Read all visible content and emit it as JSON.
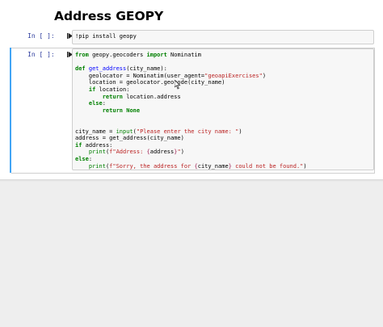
{
  "notebook": {
    "heading": "Address GEOPY",
    "cells": [
      {
        "prompt": "In [ ]:",
        "lines": [
          [
            {
              "t": "!pip install geopy",
              "c": ""
            }
          ]
        ]
      },
      {
        "prompt": "In [ ]:",
        "lines": [
          [
            {
              "t": "from",
              "c": "kw"
            },
            {
              "t": " geopy.geocoders ",
              "c": ""
            },
            {
              "t": "import",
              "c": "kw"
            },
            {
              "t": " Nominatim",
              "c": ""
            }
          ],
          [],
          [
            {
              "t": "def",
              "c": "kw"
            },
            {
              "t": " ",
              "c": ""
            },
            {
              "t": "get_address",
              "c": "fn"
            },
            {
              "t": "(city_name):",
              "c": ""
            }
          ],
          [
            {
              "t": "    geolocator = Nominatim(user_agent=",
              "c": ""
            },
            {
              "t": "\"geoapiExercises\"",
              "c": "str"
            },
            {
              "t": ")",
              "c": ""
            }
          ],
          [
            {
              "t": "    location = geolocator.geocode(city_name)",
              "c": ""
            }
          ],
          [
            {
              "t": "    ",
              "c": ""
            },
            {
              "t": "if",
              "c": "kw"
            },
            {
              "t": " location:",
              "c": ""
            }
          ],
          [
            {
              "t": "        ",
              "c": ""
            },
            {
              "t": "return",
              "c": "kw"
            },
            {
              "t": " location.address",
              "c": ""
            }
          ],
          [
            {
              "t": "    ",
              "c": ""
            },
            {
              "t": "else",
              "c": "kw"
            },
            {
              "t": ":",
              "c": ""
            }
          ],
          [
            {
              "t": "        ",
              "c": ""
            },
            {
              "t": "return",
              "c": "kw"
            },
            {
              "t": " ",
              "c": ""
            },
            {
              "t": "None",
              "c": "kw"
            }
          ],
          [],
          [],
          [
            {
              "t": "city_name = ",
              "c": ""
            },
            {
              "t": "input",
              "c": "bi"
            },
            {
              "t": "(",
              "c": ""
            },
            {
              "t": "\"Please enter the city name: \"",
              "c": "str"
            },
            {
              "t": ")",
              "c": ""
            }
          ],
          [
            {
              "t": "address = get_address(city_name)",
              "c": ""
            }
          ],
          [
            {
              "t": "if",
              "c": "kw"
            },
            {
              "t": " address:",
              "c": ""
            }
          ],
          [
            {
              "t": "    ",
              "c": ""
            },
            {
              "t": "print",
              "c": "bi"
            },
            {
              "t": "(",
              "c": ""
            },
            {
              "t": "f\"Address: ",
              "c": "str"
            },
            {
              "t": "{",
              "c": "sub"
            },
            {
              "t": "address",
              "c": ""
            },
            {
              "t": "}",
              "c": "sub"
            },
            {
              "t": "\"",
              "c": "str"
            },
            {
              "t": ")",
              "c": ""
            }
          ],
          [
            {
              "t": "else",
              "c": "kw"
            },
            {
              "t": ":",
              "c": ""
            }
          ],
          [
            {
              "t": "    ",
              "c": ""
            },
            {
              "t": "print",
              "c": "bi"
            },
            {
              "t": "(",
              "c": ""
            },
            {
              "t": "f\"Sorry, the address for ",
              "c": "str"
            },
            {
              "t": "{",
              "c": "sub"
            },
            {
              "t": "city_name",
              "c": ""
            },
            {
              "t": "}",
              "c": "sub"
            },
            {
              "t": " could not be found.\"",
              "c": "str"
            },
            {
              "t": ")",
              "c": ""
            }
          ]
        ]
      }
    ]
  },
  "icons": {
    "run": "run-cell-icon",
    "cursor": "text-cursor-icon"
  },
  "colors": {
    "selected_cell_bar": "#42a5f5",
    "prompt": "#303f9f",
    "keyword": "#008000",
    "string": "#ba2121",
    "function": "#0000ff"
  }
}
